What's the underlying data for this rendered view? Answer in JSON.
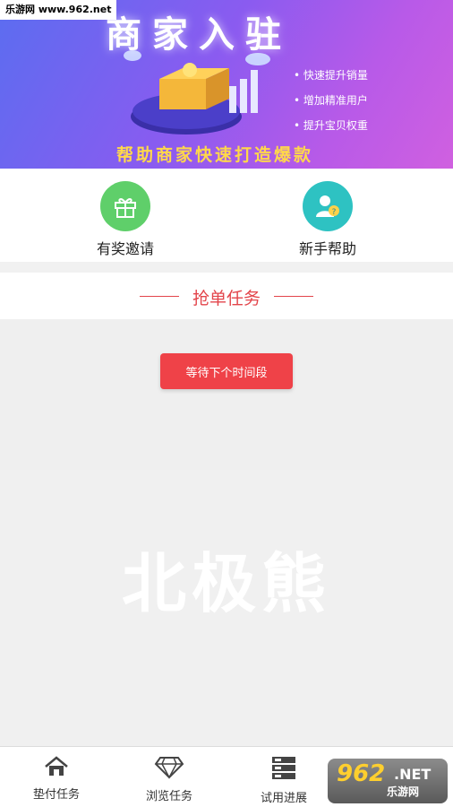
{
  "watermark": {
    "top_left": "乐游网 www.962.net",
    "center": "北极熊",
    "corner_num": "962",
    "corner_net": ".NET",
    "corner_cn": "乐游网"
  },
  "banner": {
    "title": "商家入驻",
    "bullets": [
      "快速提升销量",
      "增加精准用户",
      "提升宝贝权重"
    ],
    "slogan": "帮助商家快速打造爆款"
  },
  "quick_actions": [
    {
      "label": "有奖邀请",
      "icon": "gift-icon",
      "color": "#5fcf6a"
    },
    {
      "label": "新手帮助",
      "icon": "help-user-icon",
      "color": "#2ec2c2"
    }
  ],
  "section": {
    "title": "抢单任务"
  },
  "task": {
    "button_label": "等待下个时间段"
  },
  "tabs": [
    {
      "label": "垫付任务",
      "icon": "home-icon"
    },
    {
      "label": "浏览任务",
      "icon": "diamond-icon"
    },
    {
      "label": "试用进展",
      "icon": "server-list-icon"
    }
  ],
  "colors": {
    "accent": "#ef4248",
    "title_red": "#e3454b"
  }
}
